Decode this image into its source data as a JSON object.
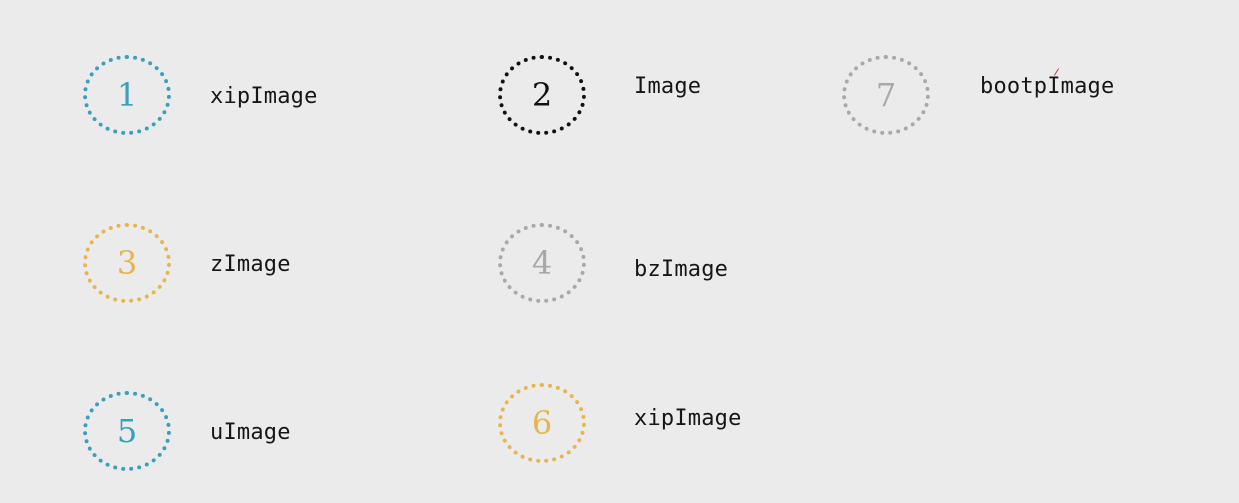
{
  "items": [
    {
      "number": "1",
      "label": "xipImage",
      "color": "#3a9fbf"
    },
    {
      "number": "2",
      "label": "Image",
      "color": "#111111"
    },
    {
      "number": "7",
      "label": "bootpImage",
      "color": "#a8a8a8"
    },
    {
      "number": "3",
      "label": "zImage",
      "color": "#e8b44f"
    },
    {
      "number": "4",
      "label": "bzImage",
      "color": "#a8a8a8"
    },
    {
      "number": "5",
      "label": "uImage",
      "color": "#3a9fbf"
    },
    {
      "number": "6",
      "label": "xipImage",
      "color": "#e8b44f"
    }
  ]
}
